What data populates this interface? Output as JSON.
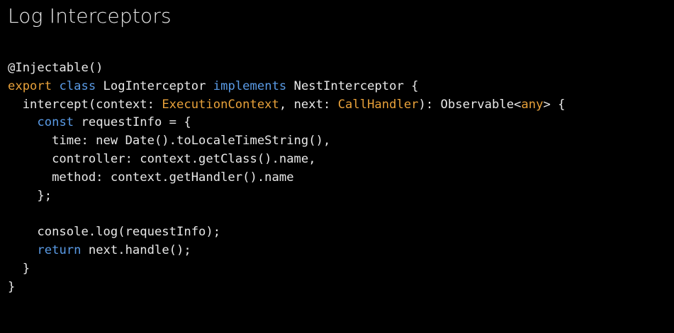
{
  "title": "Log Interceptors",
  "colors": {
    "background": "#000000",
    "text": "#e8e8e8",
    "keyword_blue": "#5a9be6",
    "keyword_orange": "#e8a13a"
  },
  "code_lines": [
    [
      {
        "t": "@Injectable()",
        "c": "plain"
      }
    ],
    [
      {
        "t": "export",
        "c": "kw-orange"
      },
      {
        "t": " ",
        "c": "plain"
      },
      {
        "t": "class",
        "c": "keyword"
      },
      {
        "t": " LogInterceptor ",
        "c": "plain"
      },
      {
        "t": "implements",
        "c": "keyword"
      },
      {
        "t": " NestInterceptor {",
        "c": "plain"
      }
    ],
    [
      {
        "t": "  intercept(context: ",
        "c": "plain"
      },
      {
        "t": "ExecutionContext",
        "c": "type"
      },
      {
        "t": ", next: ",
        "c": "plain"
      },
      {
        "t": "CallHandler",
        "c": "type"
      },
      {
        "t": "): Observable<",
        "c": "plain"
      },
      {
        "t": "any",
        "c": "type"
      },
      {
        "t": "> {",
        "c": "plain"
      }
    ],
    [
      {
        "t": "    ",
        "c": "plain"
      },
      {
        "t": "const",
        "c": "keyword"
      },
      {
        "t": " requestInfo = {",
        "c": "plain"
      }
    ],
    [
      {
        "t": "      time: new Date().toLocaleTimeString(),",
        "c": "plain"
      }
    ],
    [
      {
        "t": "      controller: context.getClass().name,",
        "c": "plain"
      }
    ],
    [
      {
        "t": "      method: context.getHandler().name",
        "c": "plain"
      }
    ],
    [
      {
        "t": "    };",
        "c": "plain"
      }
    ],
    [
      {
        "t": "",
        "c": "plain"
      }
    ],
    [
      {
        "t": "    console.log(requestInfo);",
        "c": "plain"
      }
    ],
    [
      {
        "t": "    ",
        "c": "plain"
      },
      {
        "t": "return",
        "c": "keyword"
      },
      {
        "t": " next.handle();",
        "c": "plain"
      }
    ],
    [
      {
        "t": "  }",
        "c": "plain"
      }
    ],
    [
      {
        "t": "}",
        "c": "plain"
      }
    ]
  ]
}
